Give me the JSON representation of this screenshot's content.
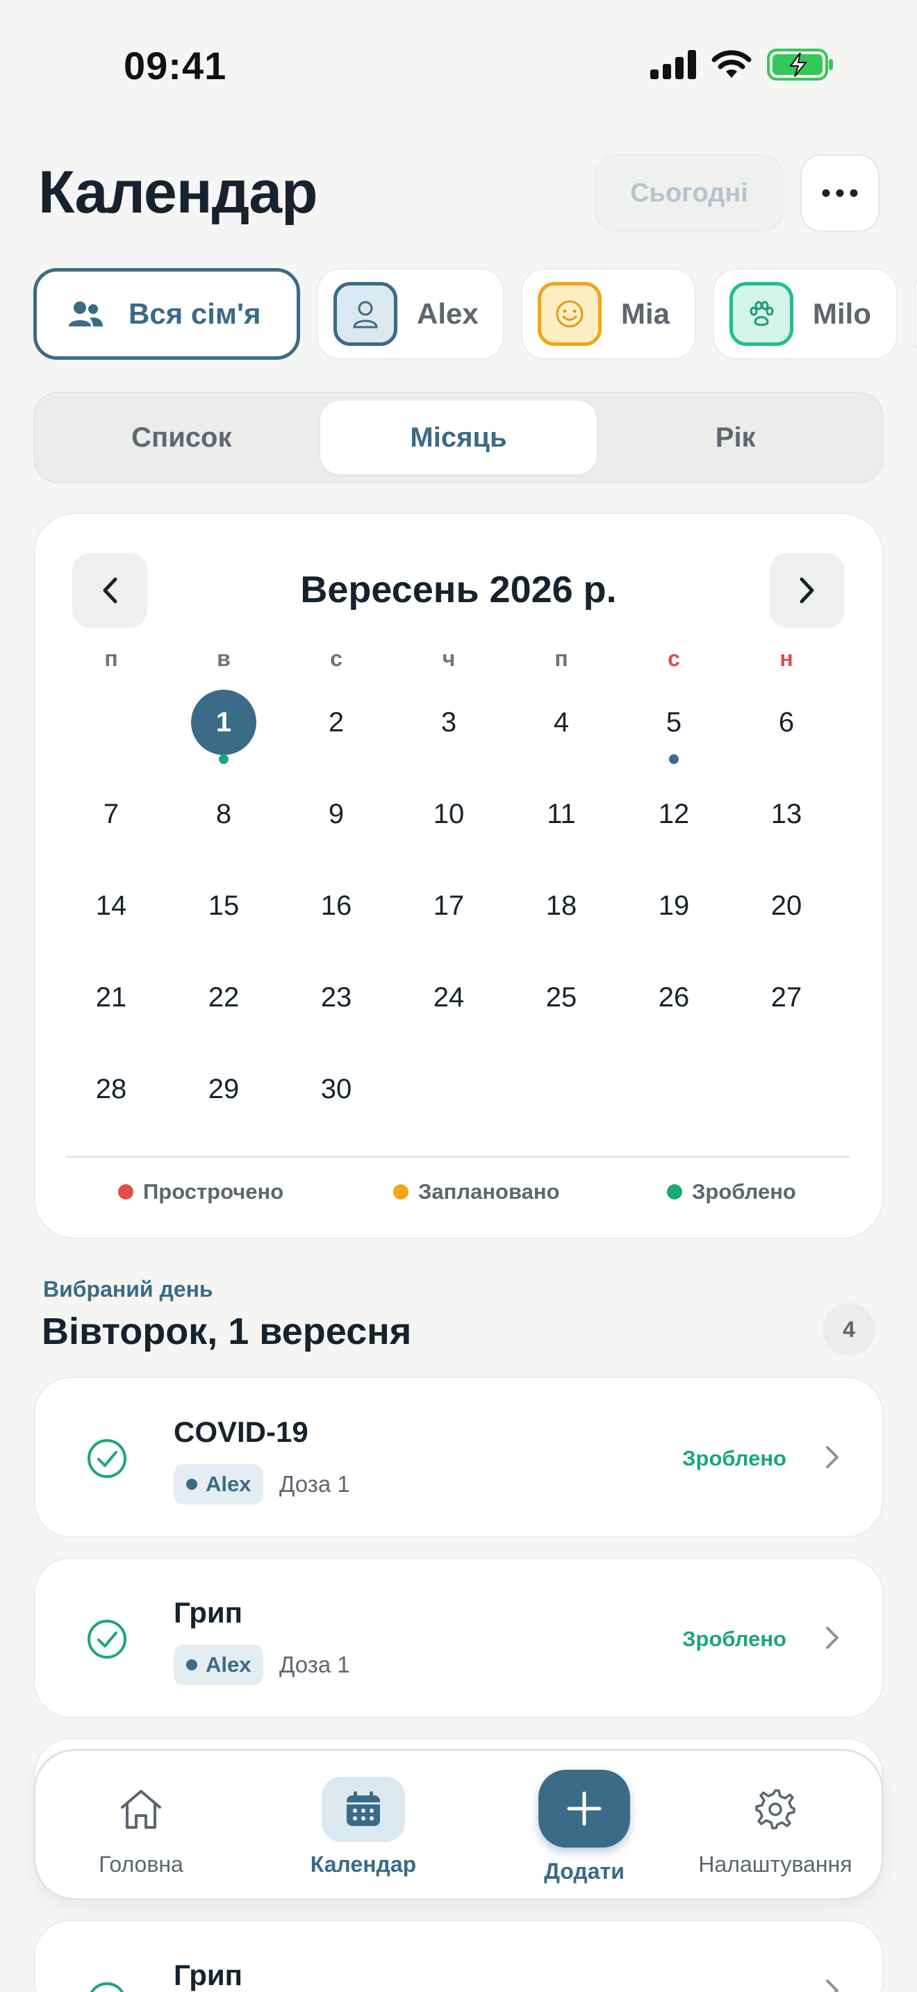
{
  "status": {
    "time": "09:41"
  },
  "header": {
    "title": "Календар",
    "today_label": "Сьогодні"
  },
  "members": [
    {
      "label": "Вся сім'я",
      "icon": "family-icon",
      "active": true
    },
    {
      "label": "Alex",
      "icon": "person-icon",
      "color": "#3a6b87"
    },
    {
      "label": "Mia",
      "icon": "smiley-icon",
      "color": "#f2a515"
    },
    {
      "label": "Milo",
      "icon": "paw-icon",
      "color": "#1fbf8a"
    }
  ],
  "views": {
    "list": "Список",
    "month": "Місяць",
    "year": "Рік",
    "active": "month"
  },
  "calendar": {
    "title": "Вересень 2026 р.",
    "weekdays": [
      "п",
      "в",
      "с",
      "ч",
      "п",
      "с",
      "н"
    ],
    "days": [
      "1",
      "2",
      "3",
      "4",
      "5",
      "6",
      "7",
      "8",
      "9",
      "10",
      "11",
      "12",
      "13",
      "14",
      "15",
      "16",
      "17",
      "18",
      "19",
      "20",
      "21",
      "22",
      "23",
      "24",
      "25",
      "26",
      "27",
      "28",
      "29",
      "30"
    ],
    "first_weekday_index": 1,
    "selected_day": "1",
    "markers": [
      {
        "day": "1",
        "color": "#1aa873"
      },
      {
        "day": "5",
        "color": "#3a6b87"
      }
    ],
    "legend": [
      {
        "label": "Прострочено",
        "color": "#e24b4b"
      },
      {
        "label": "Заплановано",
        "color": "#f2a515"
      },
      {
        "label": "Зроблено",
        "color": "#1aa873"
      }
    ]
  },
  "selected_day": {
    "caption": "Вибраний день",
    "title": "Вівторок, 1 вересня",
    "count": "4"
  },
  "events": [
    {
      "title": "COVID-19",
      "person": "Alex",
      "dose": "Доза 1",
      "status": "Зроблено"
    },
    {
      "title": "Грип",
      "person": "Alex",
      "dose": "Доза 1",
      "status": "Зроблено"
    },
    {
      "title": "Грип"
    }
  ],
  "tabbar": {
    "home": "Головна",
    "calendar": "Календар",
    "add": "Додати",
    "settings": "Налаштування"
  },
  "colors": {
    "accent": "#3a6b87",
    "done": "#1aa873",
    "overdue": "#e24b4b",
    "planned": "#f2a515"
  }
}
